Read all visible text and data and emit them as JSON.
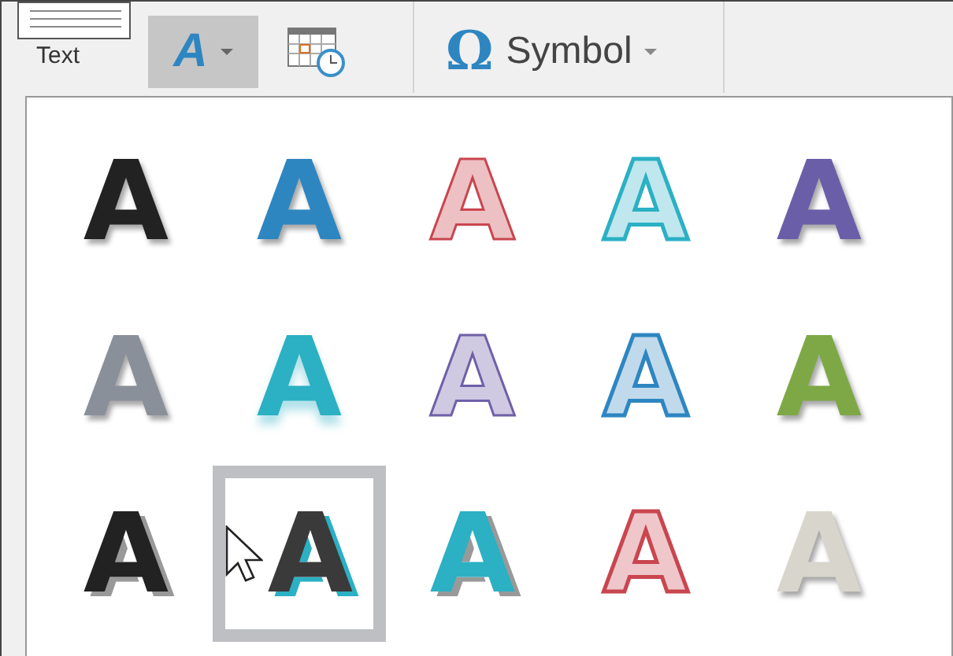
{
  "ribbon": {
    "text_label": "Text",
    "wordart_button": {
      "glyph": "A",
      "selected": true
    },
    "symbol_button": {
      "glyph": "Ω",
      "label": "Symbol"
    }
  },
  "gallery": {
    "items": [
      {
        "letter": "A",
        "kind": "solid",
        "color": "#222222",
        "selected": false
      },
      {
        "letter": "A",
        "kind": "solid",
        "color": "#2e86c1",
        "selected": false
      },
      {
        "letter": "A",
        "kind": "tint",
        "color": "#c9464f",
        "selected": false
      },
      {
        "letter": "A",
        "kind": "outline",
        "color": "#2bb0c4",
        "selected": false
      },
      {
        "letter": "A",
        "kind": "solid",
        "color": "#6b5ea8",
        "selected": false
      },
      {
        "letter": "A",
        "kind": "solid",
        "color": "#8a9099",
        "selected": false
      },
      {
        "letter": "A",
        "kind": "reflect",
        "color": "#2bb0c4",
        "selected": false
      },
      {
        "letter": "A",
        "kind": "tint",
        "color": "#7060a8",
        "selected": false
      },
      {
        "letter": "A",
        "kind": "outline",
        "color": "#2e86c1",
        "selected": false
      },
      {
        "letter": "A",
        "kind": "solid",
        "color": "#7ea845",
        "selected": false
      },
      {
        "letter": "A",
        "kind": "shadow",
        "color": "#222222",
        "selected": false
      },
      {
        "letter": "A",
        "kind": "shadow",
        "color": "#3a3a3a",
        "selected": true
      },
      {
        "letter": "A",
        "kind": "shadow",
        "color": "#2bb0c4",
        "selected": false
      },
      {
        "letter": "A",
        "kind": "outline",
        "color": "#c9464f",
        "selected": false
      },
      {
        "letter": "A",
        "kind": "solid",
        "color": "#d8d6cc",
        "selected": false
      }
    ]
  }
}
